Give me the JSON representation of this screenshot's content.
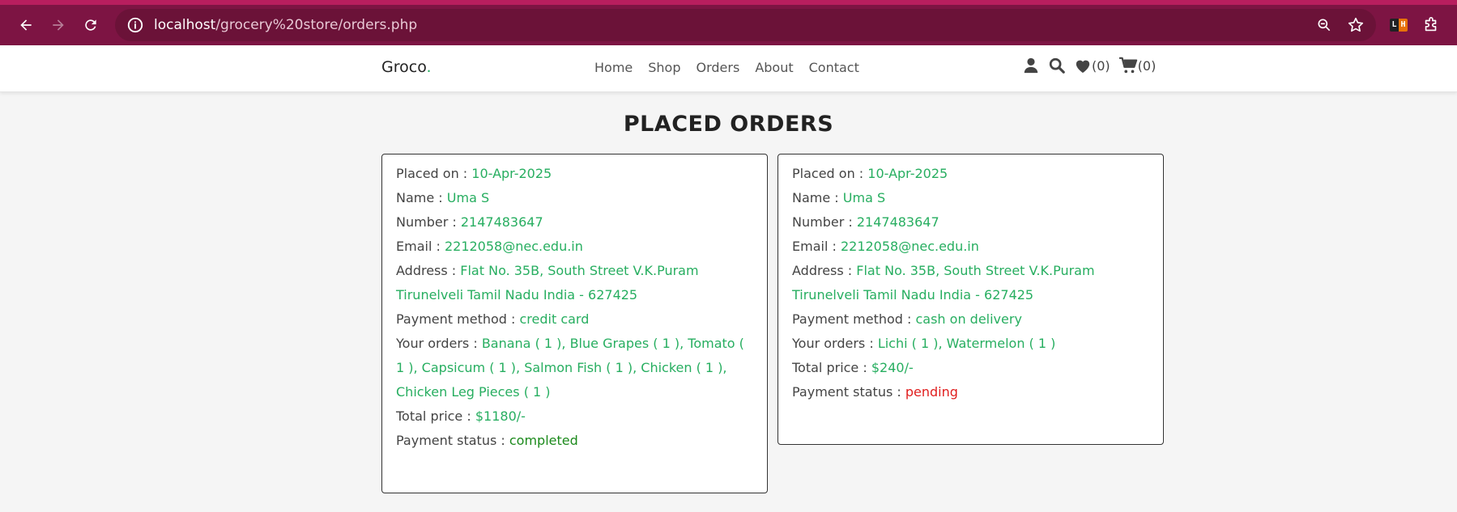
{
  "browser": {
    "url_host": "localhost",
    "url_path": "/grocery%20store/orders.php"
  },
  "header": {
    "logo_text": "Groco",
    "logo_dot": ".",
    "nav": [
      "Home",
      "Shop",
      "Orders",
      "About",
      "Contact"
    ],
    "wishlist_count": "(0)",
    "cart_count": "(0)"
  },
  "page": {
    "title": "PLACED ORDERS"
  },
  "labels": {
    "placed_on": "Placed on : ",
    "name": "Name : ",
    "number": "Number : ",
    "email": "Email : ",
    "address": "Address : ",
    "payment_method": "Payment method : ",
    "your_orders": "Your orders : ",
    "total_price": "Total price : ",
    "payment_status": "Payment status : "
  },
  "orders": [
    {
      "placed_on": "10-Apr-2025",
      "name": "Uma S",
      "number": "2147483647",
      "email": "2212058@nec.edu.in",
      "address": "Flat No. 35B, South Street V.K.Puram Tirunelveli Tamil Nadu India - 627425",
      "payment_method": "credit card",
      "items": "Banana ( 1 ), Blue Grapes ( 1 ), Tomato ( 1 ), Capsicum ( 1 ), Salmon Fish ( 1 ), Chicken ( 1 ), Chicken Leg Pieces ( 1 )",
      "total_price": "$1180/-",
      "payment_status": "completed"
    },
    {
      "placed_on": "10-Apr-2025",
      "name": "Uma S",
      "number": "2147483647",
      "email": "2212058@nec.edu.in",
      "address": "Flat No. 35B, South Street V.K.Puram Tirunelveli Tamil Nadu India - 627425",
      "payment_method": "cash on delivery",
      "items": "Lichi ( 1 ), Watermelon ( 1 )",
      "total_price": "$240/-",
      "payment_status": "pending"
    }
  ],
  "colors": {
    "value_green": "#27ae60",
    "pending_red": "#e01e1e",
    "completed_green": "#1c8a1c",
    "browser_bar": "#7d1443"
  }
}
